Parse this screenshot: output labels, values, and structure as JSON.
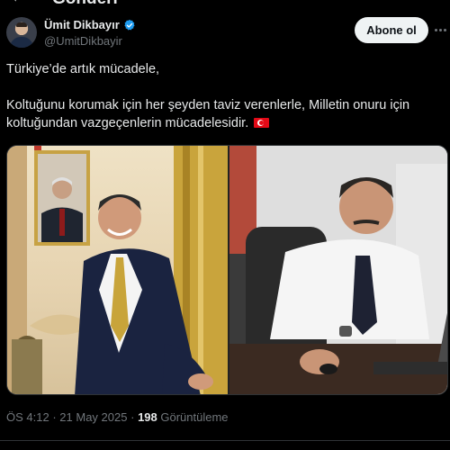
{
  "header": {
    "title": "Gönderi",
    "back_icon": "arrow-left-icon"
  },
  "author": {
    "name": "Ümit Dikbayır",
    "handle": "@UmitDikbayir",
    "verified_icon": "verified-badge-icon",
    "verified_color": "#1d9bf0"
  },
  "follow_button": {
    "label": "Abone ol"
  },
  "more_icon": "more-horizontal-icon",
  "tweet": {
    "line1": "Türkiye’de artık mücadele,",
    "line2": "Koltuğunu korumak için her şeyden taviz verenlerle, Milletin onuru için koltuğundan vazgeçenlerin mücadelesidir.",
    "emoji": "turkey-flag-icon"
  },
  "media": {
    "left_image": "photo-man-in-suit-before-portrait",
    "right_image": "photo-man-at-desk-with-laptop"
  },
  "footer": {
    "time": "ÖS 4:12",
    "separator": "·",
    "date": "21 May 2025",
    "views_count": "198",
    "views_label": "Görüntüleme"
  },
  "colors": {
    "background": "#000000",
    "text": "#e7e9ea",
    "secondary": "#71767b",
    "accent": "#1d9bf0"
  }
}
